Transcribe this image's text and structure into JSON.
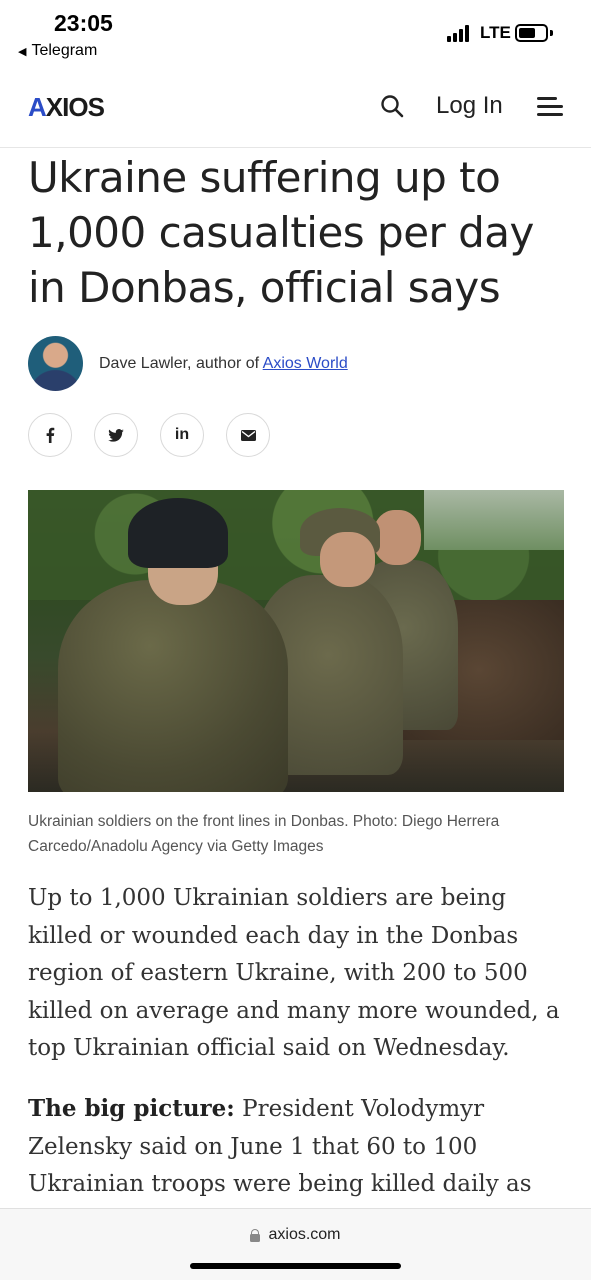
{
  "status_bar": {
    "time": "23:05",
    "back_app": "Telegram",
    "network": "LTE",
    "battery_level": 0.65
  },
  "nav": {
    "logo": "AXIOS",
    "login_label": "Log In",
    "search_icon": "search-icon",
    "menu_icon": "menu-icon"
  },
  "article": {
    "headline": "Ukraine suffering up to 1,000 casualties per day in Donbas, official says",
    "author_prefix": "Dave Lawler, author of ",
    "author_link": "Axios World",
    "share": [
      {
        "label": "f",
        "icon": "facebook-icon"
      },
      {
        "label": "𝕏",
        "icon": "twitter-icon"
      },
      {
        "label": "in",
        "icon": "linkedin-icon"
      },
      {
        "label": "✉",
        "icon": "email-icon"
      }
    ],
    "caption": "Ukrainian soldiers on the front lines in Donbas. Photo: Diego Herrera Carcedo/Anadolu Agency via Getty Images",
    "paragraph1": "Up to 1,000 Ukrainian soldiers are being killed or wounded each day in the Donbas region of eastern Ukraine, with 200 to 500 killed on average and many more wounded, a top Ukrainian official said on Wednesday.",
    "paragraph2_lead": "The big picture:",
    "paragraph2_text": " President Volodymyr Zelensky said on June 1 that 60 to 100 Ukrainian troops were being killed daily as"
  },
  "browser": {
    "url": "axios.com"
  }
}
